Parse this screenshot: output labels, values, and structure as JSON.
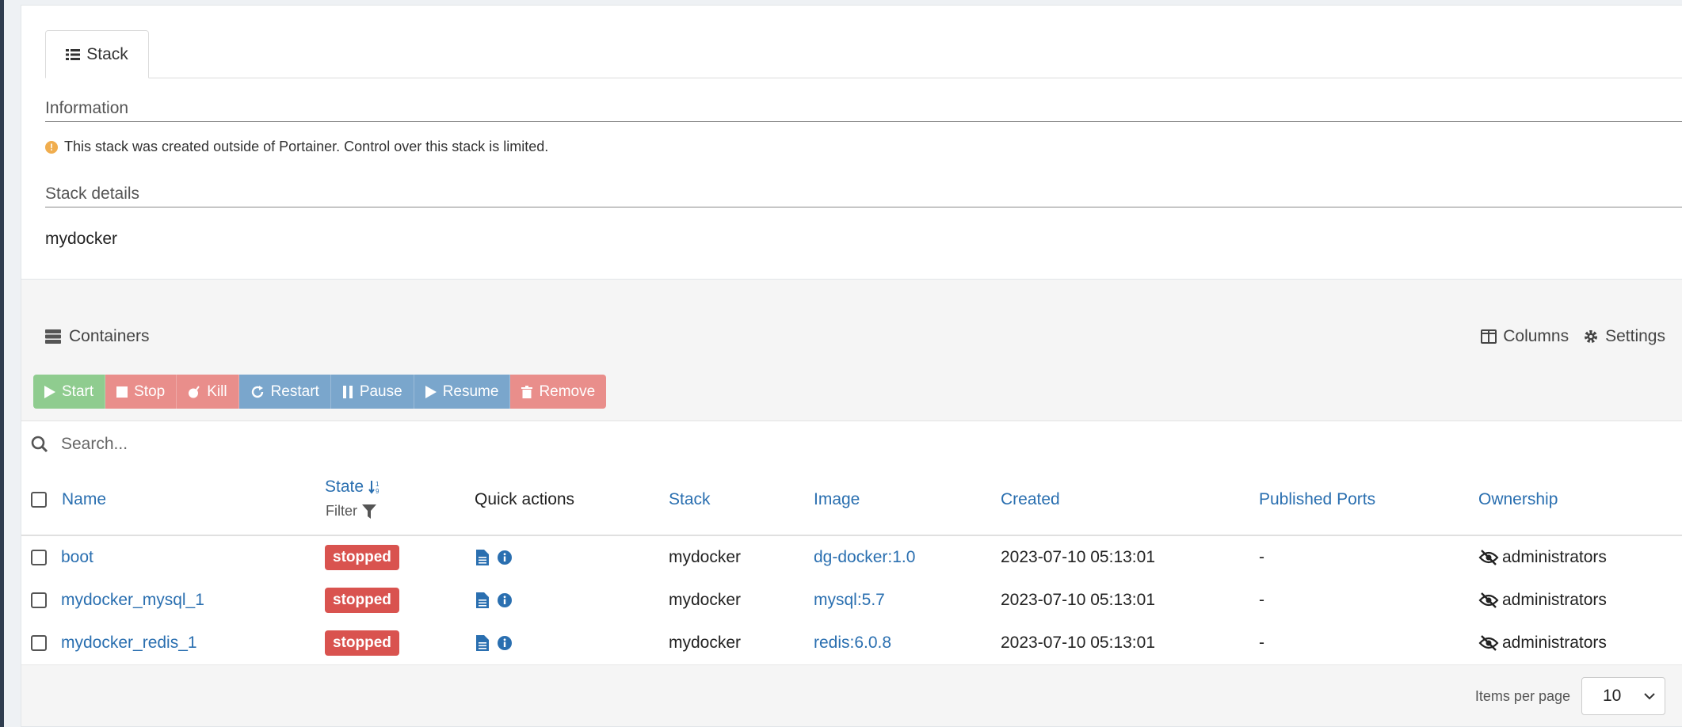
{
  "stack_panel": {
    "tab_label": "Stack",
    "information_title": "Information",
    "info_message": "This stack was created outside of Portainer. Control over this stack is limited.",
    "details_title": "Stack details",
    "stack_name": "mydocker"
  },
  "containers_panel": {
    "title": "Containers",
    "columns_label": "Columns",
    "settings_label": "Settings",
    "actions": {
      "start": "Start",
      "stop": "Stop",
      "kill": "Kill",
      "restart": "Restart",
      "pause": "Pause",
      "resume": "Resume",
      "remove": "Remove"
    },
    "search": {
      "placeholder": "Search..."
    },
    "headers": {
      "name": "Name",
      "state": "State",
      "state_filter": "Filter",
      "quick_actions": "Quick actions",
      "stack": "Stack",
      "image": "Image",
      "created": "Created",
      "ports": "Published Ports",
      "ownership": "Ownership"
    },
    "rows": [
      {
        "name": "boot",
        "state": "stopped",
        "stack": "mydocker",
        "image": "dg-docker:1.0",
        "created": "2023-07-10 05:13:01",
        "ports": "-",
        "ownership": "administrators"
      },
      {
        "name": "mydocker_mysql_1",
        "state": "stopped",
        "stack": "mydocker",
        "image": "mysql:5.7",
        "created": "2023-07-10 05:13:01",
        "ports": "-",
        "ownership": "administrators"
      },
      {
        "name": "mydocker_redis_1",
        "state": "stopped",
        "stack": "mydocker",
        "image": "redis:6.0.8",
        "created": "2023-07-10 05:13:01",
        "ports": "-",
        "ownership": "administrators"
      }
    ],
    "footer": {
      "items_per_page_label": "Items per page",
      "items_per_page_value": "10"
    }
  },
  "colors": {
    "link": "#2a6fb0",
    "stopped_badge": "#d9534f",
    "warning": "#f0ad4e"
  }
}
